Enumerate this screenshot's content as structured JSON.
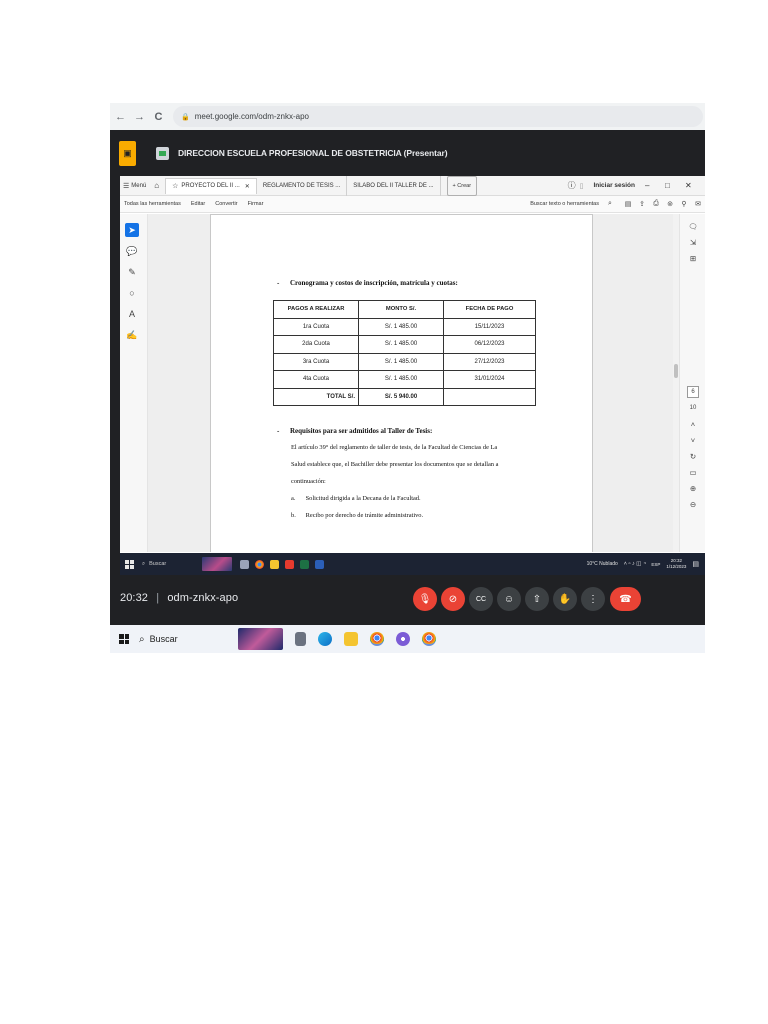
{
  "browser": {
    "back": "←",
    "forward": "→",
    "reload": "C",
    "url": "meet.google.com/odm-znkx-apo"
  },
  "meet": {
    "presentation_title": "DIRECCION ESCUELA PROFESIONAL DE OBSTETRICIA (Presentar)",
    "clock": "20:32",
    "separator": "|",
    "meeting_code": "odm-znkx-apo"
  },
  "acrobat": {
    "menu_label": "Menú",
    "tabs": [
      "PROYECTO DEL II ...",
      "REGLAMENTO DE TESIS ...",
      "SILABO DEL II TALLER DE ..."
    ],
    "new_tab": "+ Crear",
    "login": "Iniciar sesión",
    "toolbar": {
      "all_tools": "Todas las herramientas",
      "edit": "Editar",
      "convert": "Convertir",
      "sign": "Firmar",
      "search": "Buscar texto o herramientas"
    },
    "page_number": "6",
    "page_total": "10"
  },
  "document": {
    "bullet": "-",
    "section1_title": "Cronograma y costos de inscripción, matrícula y cuotas:",
    "table": {
      "headers": [
        "PAGOS A REALIZAR",
        "MONTO S/.",
        "FECHA DE PAGO"
      ],
      "rows": [
        [
          "1ra Cuota",
          "S/. 1 485.00",
          "15/11/2023"
        ],
        [
          "2da Cuota",
          "S/. 1 485.00",
          "06/12/2023"
        ],
        [
          "3ra Cuota",
          "S/. 1 485.00",
          "27/12/2023"
        ],
        [
          "4ta Cuota",
          "S/. 1 485.00",
          "31/01/2024"
        ]
      ],
      "total_label": "TOTAL S/.",
      "total_value": "S/. 5 940.00"
    },
    "section2_title": "Requisitos para ser admitidos al Taller de Tesis:",
    "paragraph_lines": [
      "El artículo 39° del reglamento de taller de tesis, de la Facultad de Ciencias de La",
      "Salud establece que, el Bachiller debe presentar los documentos que se detallan a",
      "continuación:"
    ],
    "list": [
      {
        "marker": "a.",
        "text": "Solicitud dirigida a la Decana de la Facultad."
      },
      {
        "marker": "b.",
        "text": "Recibo por derecho de trámite administrativo."
      }
    ]
  },
  "inner_taskbar": {
    "search": "Buscar",
    "weather": "10°C  Nublado",
    "lang": "ESP",
    "time": "20:32",
    "date": "1/12/2023"
  },
  "outer_taskbar": {
    "search": "Buscar"
  },
  "colors": {
    "meet_bg": "#202124",
    "end_call": "#ea4335",
    "present_badge": "#f9ab00",
    "acrobat_select": "#1473e6"
  }
}
